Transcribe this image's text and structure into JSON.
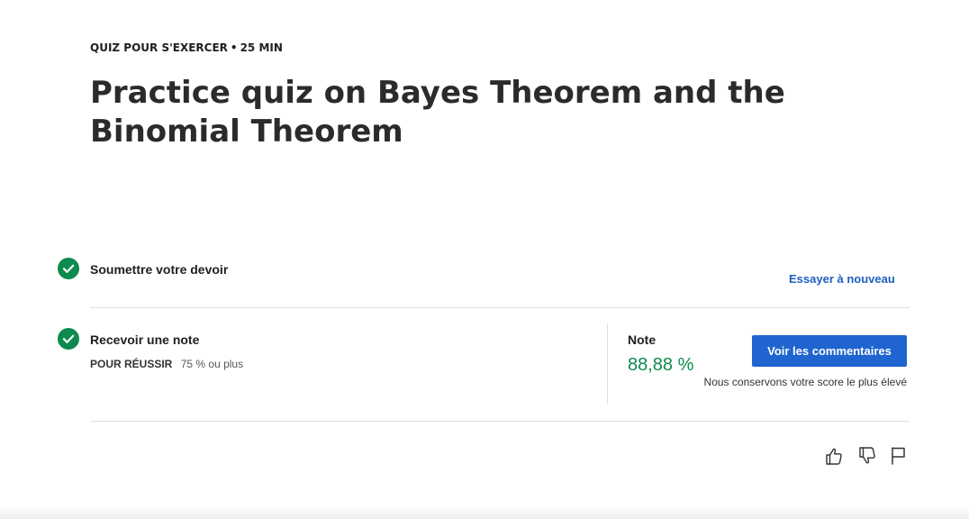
{
  "header": {
    "category": "QUIZ POUR S'EXERCER",
    "separator": "•",
    "duration": "25  MIN",
    "title": "Practice quiz on Bayes Theorem and the Binomial Theorem"
  },
  "steps": [
    {
      "label": "Soumettre votre devoir",
      "action_label": "Essayer à nouveau",
      "status": "completed"
    },
    {
      "label": "Recevoir une note",
      "pass_label": "POUR RÉUSSIR",
      "pass_value": "75 % ou plus",
      "status": "completed"
    }
  ],
  "grade": {
    "label": "Note",
    "value": "88,88 %",
    "button_label": "Voir les commentaires",
    "note": "Nous conservons votre score le plus élevé"
  },
  "feedback_icons": [
    "thumbs-up-icon",
    "thumbs-down-icon",
    "flag-icon"
  ],
  "colors": {
    "success": "#0d8a4e",
    "accent": "#1f64cf",
    "link": "#1f5fbf"
  }
}
